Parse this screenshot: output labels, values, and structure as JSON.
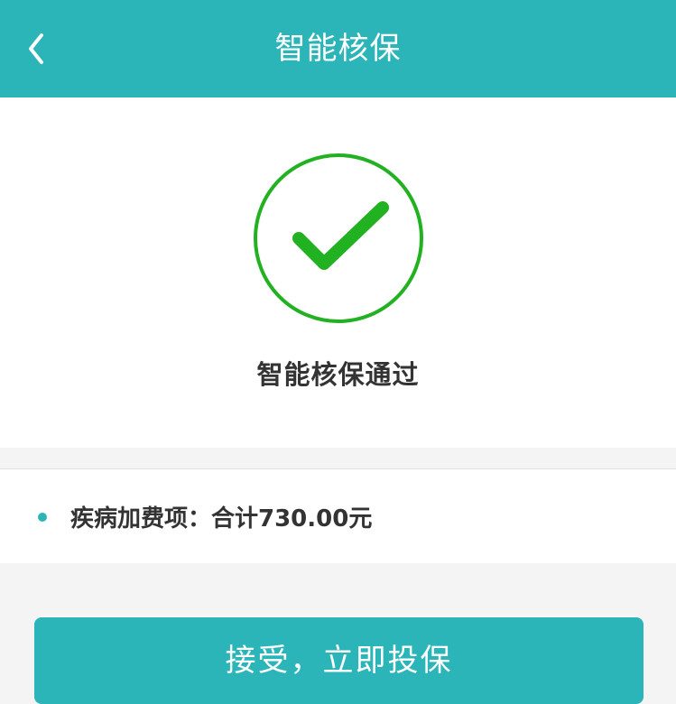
{
  "header": {
    "title": "智能核保"
  },
  "result": {
    "message": "智能核保通过"
  },
  "fee": {
    "label": "疾病加费项：合计730.00元"
  },
  "actions": {
    "accept_label": "接受，立即投保"
  },
  "colors": {
    "primary": "#2bb5b9",
    "success": "#21b121",
    "text": "#333333",
    "background": "#f4f4f4"
  },
  "icons": {
    "back": "chevron-left-icon",
    "success": "check-circle-icon"
  }
}
